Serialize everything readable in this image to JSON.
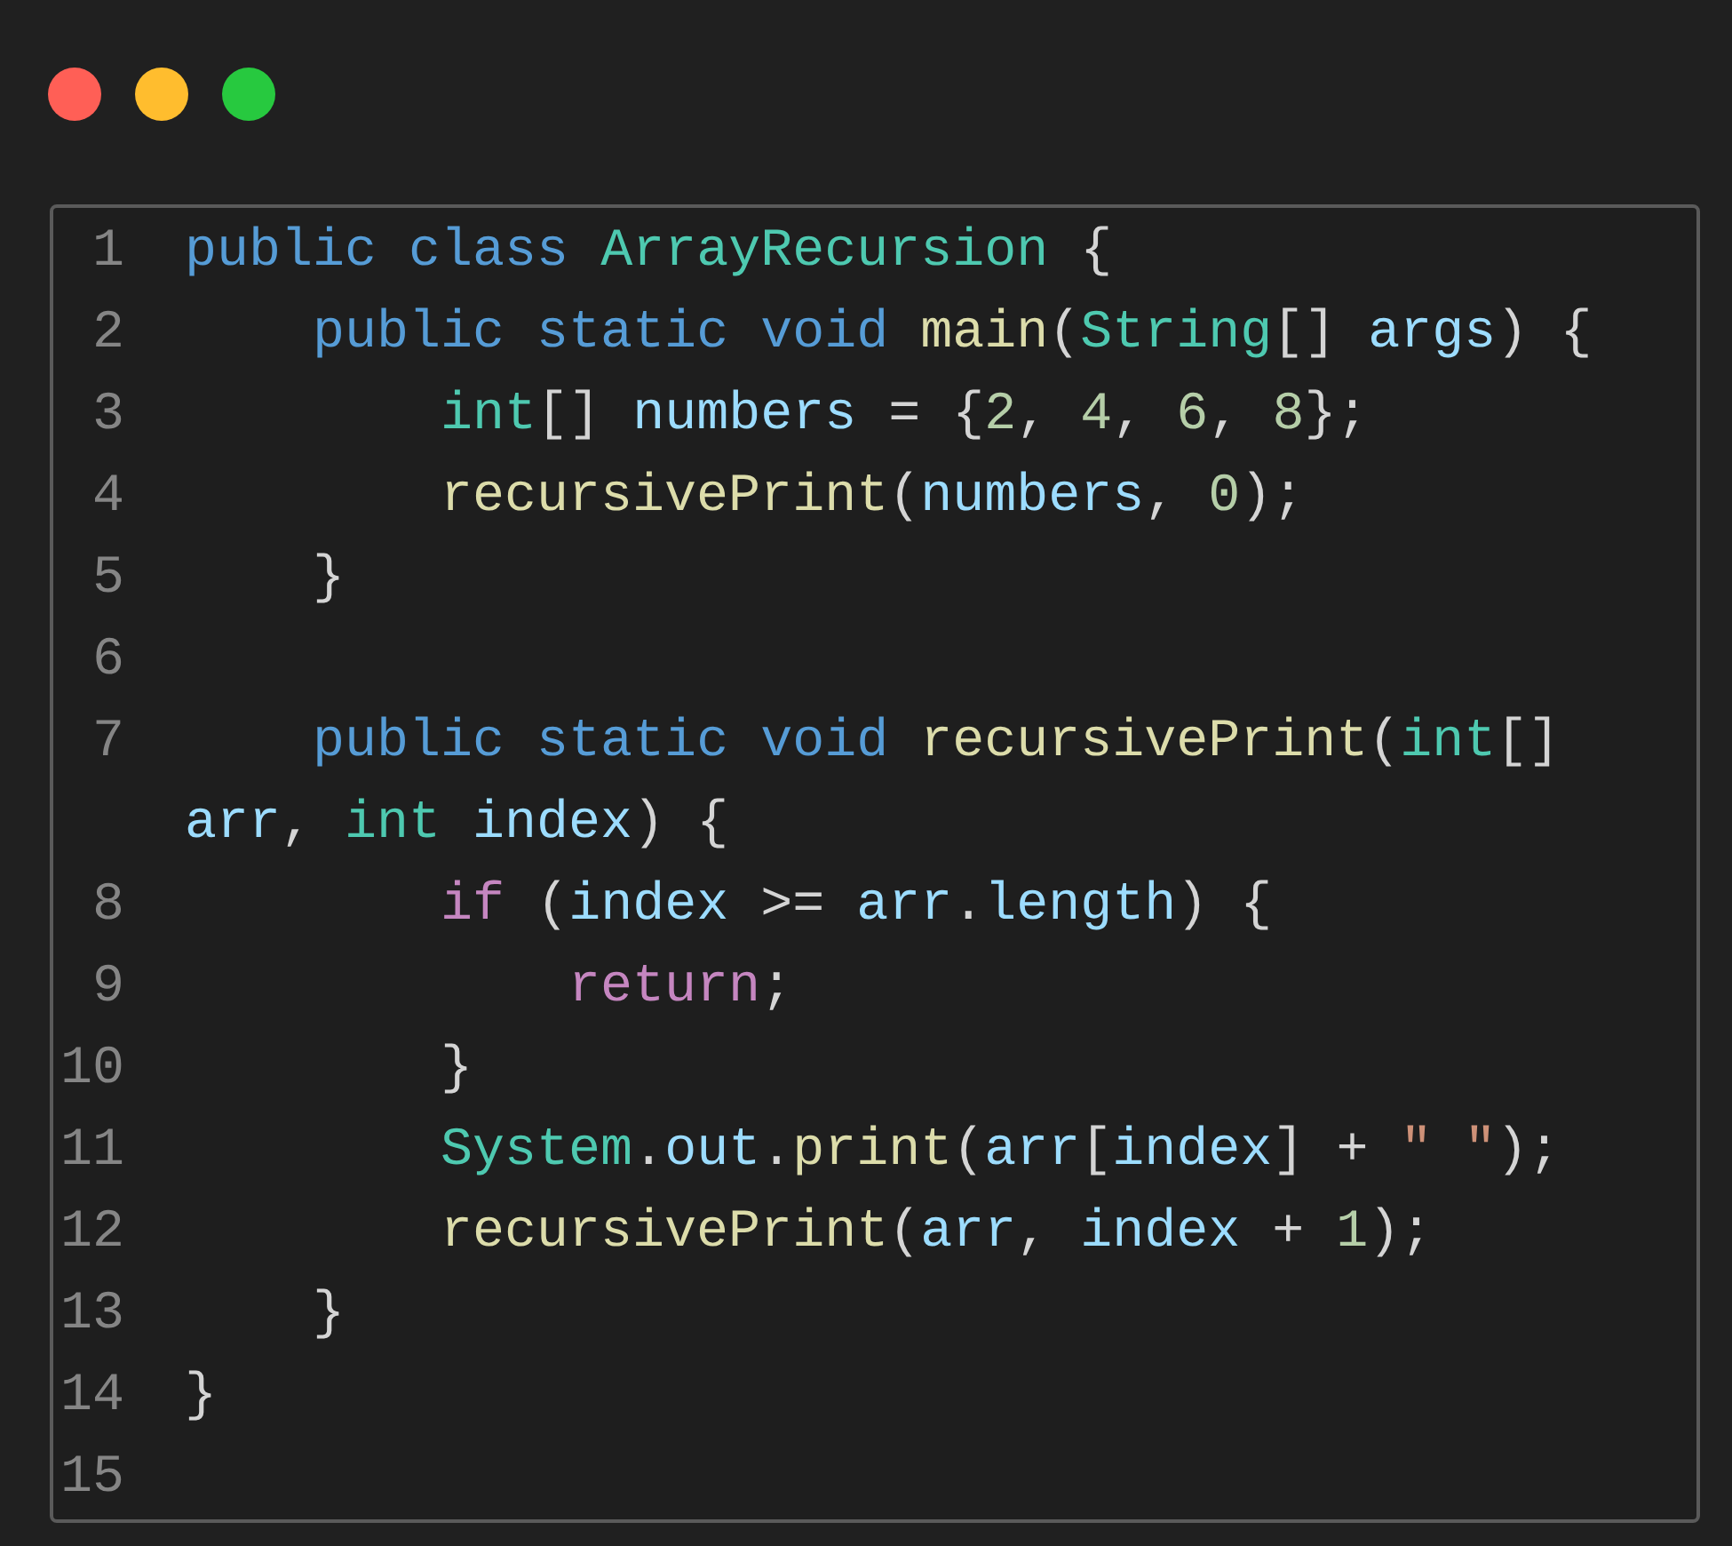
{
  "window": {
    "buttons": [
      {
        "kind": "close"
      },
      {
        "kind": "minimize"
      },
      {
        "kind": "zoom"
      }
    ]
  },
  "code": {
    "lines": [
      {
        "number": "1",
        "tokens": [
          {
            "kind": "kw",
            "text": "public"
          },
          {
            "kind": "kw",
            "text": " class"
          },
          {
            "kind": "type",
            "text": " ArrayRecursion"
          },
          {
            "kind": "plain",
            "text": " {"
          }
        ]
      },
      {
        "number": "2",
        "tokens": [
          {
            "kind": "kw",
            "text": "    public"
          },
          {
            "kind": "kw",
            "text": " static"
          },
          {
            "kind": "kw",
            "text": " void"
          },
          {
            "kind": "fn",
            "text": " main"
          },
          {
            "kind": "plain",
            "text": "("
          },
          {
            "kind": "type",
            "text": "String"
          },
          {
            "kind": "plain",
            "text": "[]"
          },
          {
            "kind": "var",
            "text": " args"
          },
          {
            "kind": "plain",
            "text": ") {"
          }
        ]
      },
      {
        "number": "3",
        "tokens": [
          {
            "kind": "type",
            "text": "        int"
          },
          {
            "kind": "plain",
            "text": "[]"
          },
          {
            "kind": "var",
            "text": " numbers"
          },
          {
            "kind": "plain",
            "text": " = {"
          },
          {
            "kind": "num",
            "text": "2"
          },
          {
            "kind": "plain",
            "text": ","
          },
          {
            "kind": "num",
            "text": " 4"
          },
          {
            "kind": "plain",
            "text": ","
          },
          {
            "kind": "num",
            "text": " 6"
          },
          {
            "kind": "plain",
            "text": ","
          },
          {
            "kind": "num",
            "text": " 8"
          },
          {
            "kind": "plain",
            "text": "};"
          }
        ]
      },
      {
        "number": "4",
        "tokens": [
          {
            "kind": "fn",
            "text": "        recursivePrint"
          },
          {
            "kind": "plain",
            "text": "("
          },
          {
            "kind": "var",
            "text": "numbers"
          },
          {
            "kind": "plain",
            "text": ","
          },
          {
            "kind": "num",
            "text": " 0"
          },
          {
            "kind": "plain",
            "text": ");"
          }
        ]
      },
      {
        "number": "5",
        "tokens": [
          {
            "kind": "plain",
            "text": "    }"
          }
        ]
      },
      {
        "number": "6"
      },
      {
        "number": "7",
        "tokens": [
          {
            "kind": "kw",
            "text": "    public"
          },
          {
            "kind": "kw",
            "text": " static"
          },
          {
            "kind": "kw",
            "text": " void"
          },
          {
            "kind": "fn",
            "text": " recursivePrint"
          },
          {
            "kind": "plain",
            "text": "("
          },
          {
            "kind": "type",
            "text": "int"
          },
          {
            "kind": "plain",
            "text": "[]"
          },
          {
            "kind": "var",
            "text": " arr"
          },
          {
            "kind": "plain",
            "text": ","
          },
          {
            "kind": "type",
            "text": " int"
          },
          {
            "kind": "var",
            "text": " index"
          },
          {
            "kind": "plain",
            "text": ") {"
          }
        ]
      },
      {
        "number": "8",
        "tokens": [
          {
            "kind": "ctl",
            "text": "        if"
          },
          {
            "kind": "plain",
            "text": " ("
          },
          {
            "kind": "var",
            "text": "index"
          },
          {
            "kind": "plain",
            "text": " >="
          },
          {
            "kind": "var",
            "text": " arr"
          },
          {
            "kind": "plain",
            "text": "."
          },
          {
            "kind": "var",
            "text": "length"
          },
          {
            "kind": "plain",
            "text": ") {"
          }
        ]
      },
      {
        "number": "9",
        "tokens": [
          {
            "kind": "ctl",
            "text": "            return"
          },
          {
            "kind": "plain",
            "text": ";"
          }
        ]
      },
      {
        "number": "10",
        "tokens": [
          {
            "kind": "plain",
            "text": "        }"
          }
        ]
      },
      {
        "number": "11",
        "tokens": [
          {
            "kind": "type",
            "text": "        System"
          },
          {
            "kind": "plain",
            "text": "."
          },
          {
            "kind": "var",
            "text": "out"
          },
          {
            "kind": "plain",
            "text": "."
          },
          {
            "kind": "fn",
            "text": "print"
          },
          {
            "kind": "plain",
            "text": "("
          },
          {
            "kind": "var",
            "text": "arr"
          },
          {
            "kind": "plain",
            "text": "["
          },
          {
            "kind": "var",
            "text": "index"
          },
          {
            "kind": "plain",
            "text": "] +"
          },
          {
            "kind": "str",
            "text": " \" \""
          },
          {
            "kind": "plain",
            "text": ");"
          }
        ]
      },
      {
        "number": "12",
        "tokens": [
          {
            "kind": "fn",
            "text": "        recursivePrint"
          },
          {
            "kind": "plain",
            "text": "("
          },
          {
            "kind": "var",
            "text": "arr"
          },
          {
            "kind": "plain",
            "text": ","
          },
          {
            "kind": "var",
            "text": " index"
          },
          {
            "kind": "plain",
            "text": " +"
          },
          {
            "kind": "num",
            "text": " 1"
          },
          {
            "kind": "plain",
            "text": ");"
          }
        ]
      },
      {
        "number": "13",
        "tokens": [
          {
            "kind": "plain",
            "text": "    }"
          }
        ]
      },
      {
        "number": "14",
        "tokens": [
          {
            "kind": "plain",
            "text": "}"
          }
        ]
      },
      {
        "number": "15"
      }
    ]
  }
}
